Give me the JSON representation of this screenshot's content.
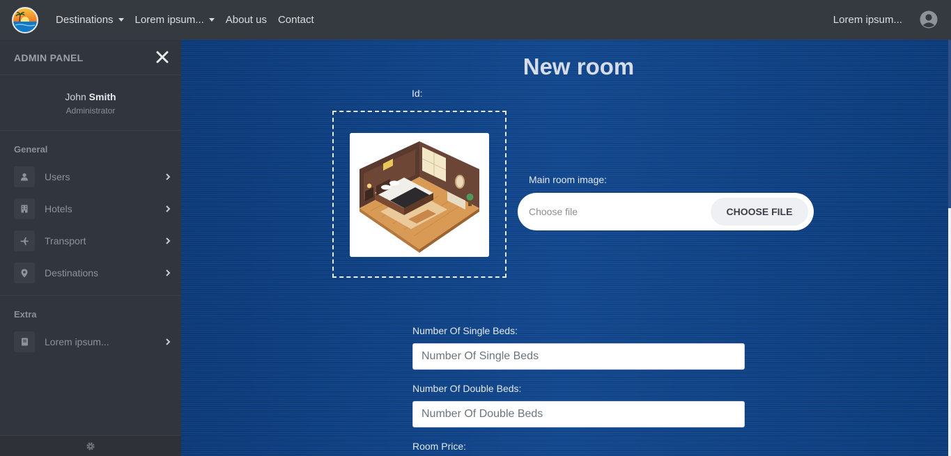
{
  "navbar": {
    "links": [
      {
        "label": "Destinations",
        "dropdown": true
      },
      {
        "label": "Lorem ipsum...",
        "dropdown": true
      },
      {
        "label": "About us",
        "dropdown": false
      },
      {
        "label": "Contact",
        "dropdown": false
      }
    ],
    "right_label": "Lorem ipsum..."
  },
  "sidebar": {
    "title": "ADMIN PANEL",
    "user": {
      "first_name": "John",
      "last_name": "Smith",
      "role": "Administrator"
    },
    "sections": [
      {
        "title": "General",
        "items": [
          {
            "label": "Users",
            "icon": "user-icon"
          },
          {
            "label": "Hotels",
            "icon": "building-icon"
          },
          {
            "label": "Transport",
            "icon": "plane-icon"
          },
          {
            "label": "Destinations",
            "icon": "map-pin-icon"
          }
        ]
      },
      {
        "title": "Extra",
        "items": [
          {
            "label": "Lorem ipsum...",
            "icon": "book-icon"
          }
        ]
      }
    ]
  },
  "form": {
    "title": "New room",
    "id_label": "Id:",
    "image_label": "Main room image:",
    "file_placeholder": "Choose file",
    "file_button": "CHOOSE FILE",
    "single_beds_label": "Number Of Single Beds:",
    "single_beds_placeholder": "Number Of Single Beds",
    "double_beds_label": "Number Of Double Beds:",
    "double_beds_placeholder": "Number Of Double Beds",
    "price_label": "Room Price:"
  },
  "colors": {
    "navbar": "#343a40",
    "sidebar": "#31353d",
    "main_background": "#0e3e80"
  }
}
